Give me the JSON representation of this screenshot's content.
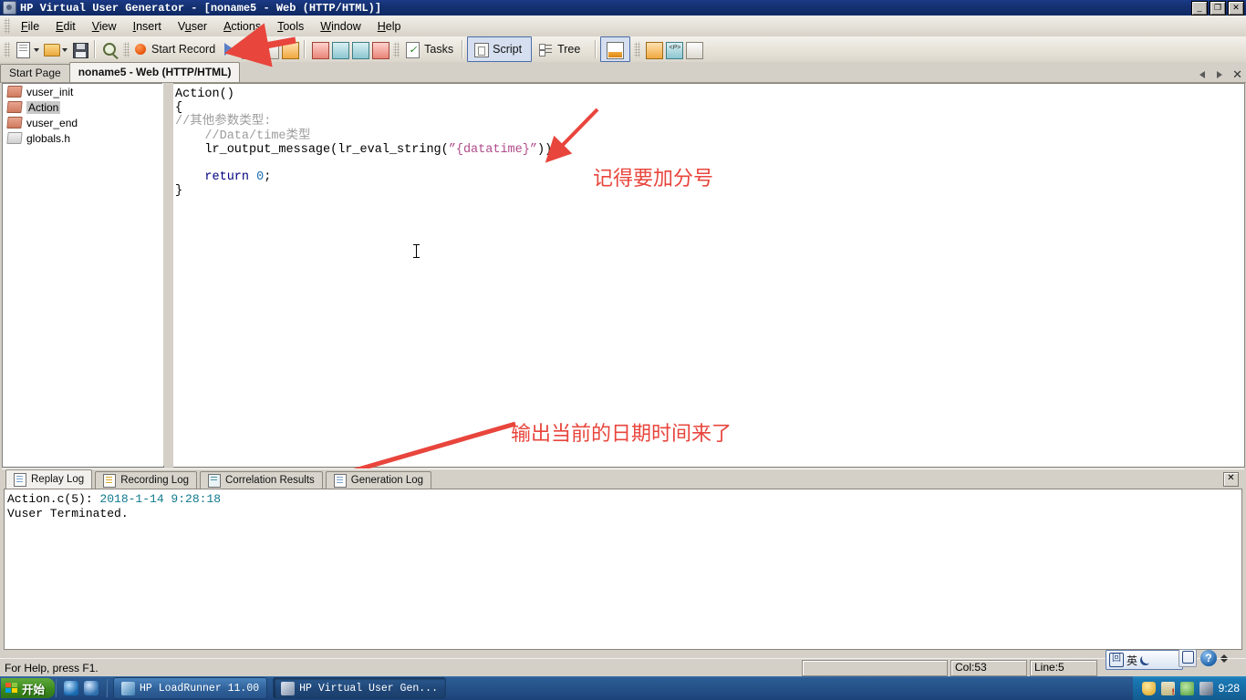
{
  "window": {
    "title": "HP Virtual User Generator - [noname5 - Web (HTTP/HTML)]",
    "minimize_label": "_",
    "restore_label": "❐",
    "close_label": "✕"
  },
  "menubar": {
    "items": [
      {
        "pre": "",
        "accel": "F",
        "post": "ile"
      },
      {
        "pre": "",
        "accel": "E",
        "post": "dit"
      },
      {
        "pre": "",
        "accel": "V",
        "post": "iew"
      },
      {
        "pre": "",
        "accel": "I",
        "post": "nsert"
      },
      {
        "pre": "V",
        "accel": "u",
        "post": "ser"
      },
      {
        "pre": "",
        "accel": "A",
        "post": "ctions"
      },
      {
        "pre": "",
        "accel": "T",
        "post": "ools"
      },
      {
        "pre": "",
        "accel": "W",
        "post": "indow"
      },
      {
        "pre": "",
        "accel": "H",
        "post": "elp"
      }
    ]
  },
  "toolbar": {
    "new_icon": "new-script-icon",
    "open_icon": "open-folder-icon",
    "save_icon": "save-icon",
    "find_icon": "zoom-find-icon",
    "start_record_label": "Start Record",
    "run_icon": "run-play-icon",
    "stop_icon": "stop-icon",
    "pause_icon": "pause-icon",
    "download_icon": "download-icon",
    "param_icon": "parameter-list-icon",
    "runtime_icon": "runtime-settings-icon",
    "runstep_icon": "run-step-icon",
    "snapshot_icon": "snapshot-icon",
    "tasks_label": "Tasks",
    "script_label": "Script",
    "tree_label": "Tree",
    "split_icon": "split-view-icon",
    "compare_icon": "compare-icon",
    "protocol_icon": "protocol-p-icon",
    "report_icon": "report-icon"
  },
  "tabs": {
    "items": [
      {
        "label": "Start Page",
        "active": false
      },
      {
        "label": "noname5 - Web (HTTP/HTML)",
        "active": true
      }
    ],
    "nav_prev_icon": "chevron-left-icon",
    "nav_next_icon": "chevron-right-icon",
    "close_label": "✕"
  },
  "tree": {
    "items": [
      {
        "label": "vuser_init",
        "icon": "action-block-icon",
        "selected": false
      },
      {
        "label": "Action",
        "icon": "action-block-icon",
        "selected": true
      },
      {
        "label": "vuser_end",
        "icon": "action-block-icon",
        "selected": false
      },
      {
        "label": "globals.h",
        "icon": "header-file-icon",
        "selected": false
      }
    ]
  },
  "editor": {
    "lines": [
      [
        {
          "t": "Action()",
          "c": "plain"
        }
      ],
      [
        {
          "t": "{",
          "c": "plain"
        }
      ],
      [
        {
          "t": "//其他参数类型:",
          "c": "comment"
        }
      ],
      [
        {
          "t": "    //Data/time类型",
          "c": "comment"
        }
      ],
      [
        {
          "t": "    lr_output_message(lr_eval_string(",
          "c": "plain"
        },
        {
          "t": "\"{datatime}\"",
          "c": "str"
        },
        {
          "t": "));",
          "c": "plain"
        }
      ],
      [
        {
          "t": "",
          "c": "plain"
        }
      ],
      [
        {
          "t": "    ",
          "c": "plain"
        },
        {
          "t": "return",
          "c": "kw"
        },
        {
          "t": " ",
          "c": "plain"
        },
        {
          "t": "0",
          "c": "num"
        },
        {
          "t": ";",
          "c": "plain"
        }
      ],
      [
        {
          "t": "}",
          "c": "plain"
        }
      ]
    ]
  },
  "annotations": [
    {
      "text": "记得要加分号",
      "name": "annotation-semicolon"
    },
    {
      "text": "输出当前的日期时间来了",
      "name": "annotation-output-datetime"
    }
  ],
  "log": {
    "tabs": [
      {
        "label": "Replay Log",
        "active": true
      },
      {
        "label": "Recording Log",
        "active": false
      },
      {
        "label": "Correlation Results",
        "active": false
      },
      {
        "label": "Generation Log",
        "active": false
      }
    ],
    "close_label": "✕",
    "lines": [
      {
        "prefix": "Action.c(5): ",
        "time": "2018-1-14 9:28:18"
      },
      {
        "prefix": "Vuser Terminated.",
        "time": ""
      }
    ]
  },
  "statusbar": {
    "hint": "For Help, press F1.",
    "blank": "",
    "col": "Col:53",
    "line": "Line:5"
  },
  "ime": {
    "mode_icon": "ime-input-icon",
    "mode_label": "英",
    "moon_icon": "ime-moon-icon",
    "pad_icon": "ime-pad-icon",
    "help_label": "?",
    "spin_icon": "ime-spinner-icon"
  },
  "taskbar": {
    "start_label": "开始",
    "quick": [
      {
        "icon": "internet-explorer-icon"
      },
      {
        "icon": "media-player-icon"
      }
    ],
    "buttons": [
      {
        "label": "HP LoadRunner 11.00",
        "icon": "loadrunner-icon",
        "active": false
      },
      {
        "label": "HP Virtual User Gen...",
        "icon": "vugen-icon",
        "active": true
      }
    ],
    "tray_icons": [
      "security-shield-icon",
      "warning-icon",
      "network-icon",
      "antivirus-icon"
    ],
    "clock": "9:28"
  },
  "colors": {
    "titlebar": "#14306f",
    "accent_red": "#e8453c",
    "chrome": "#d4d0c8",
    "log_time": "#0f7a8c"
  }
}
